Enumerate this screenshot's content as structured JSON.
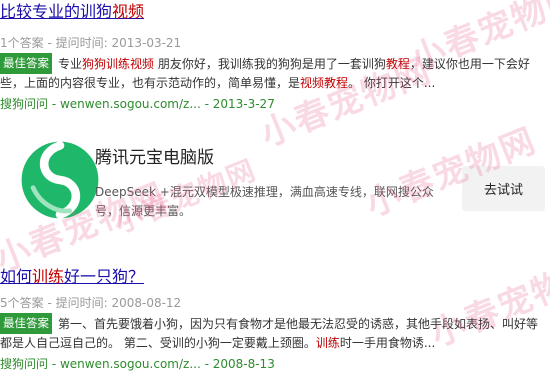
{
  "results": [
    {
      "title_parts": [
        {
          "text": "比较专业的训狗",
          "hl": false
        },
        {
          "text": "视频",
          "hl": true
        }
      ],
      "meta": "1个答案 - 提问时间: 2013-03-21",
      "badge": "最佳答案",
      "snippet_parts": [
        {
          "text": "专业",
          "hl": false
        },
        {
          "text": "狗狗训练视频",
          "hl": true
        },
        {
          "text": " 朋友你好，我训练我的狗狗是用了一套训狗",
          "hl": false
        },
        {
          "text": "教程",
          "hl": true
        },
        {
          "text": "，建议你也用一下会好些，上面的内容很专业，也有示范动作的，简单易懂，是",
          "hl": false
        },
        {
          "text": "视频教程",
          "hl": true
        },
        {
          "text": "。 你打开这个...",
          "hl": false
        }
      ],
      "source": "搜狗问问 - wenwen.sogou.com/z... - 2013-3-27"
    },
    {
      "title_parts": [
        {
          "text": "如何",
          "hl": false
        },
        {
          "text": "训练",
          "hl": true
        },
        {
          "text": "好一只狗？",
          "hl": false
        }
      ],
      "meta": "5个答案 - 提问时间: 2008-08-12",
      "badge": "最佳答案",
      "snippet_parts": [
        {
          "text": "第一、首先要饿着小狗，因为只有食物才是他最无法忍受的诱惑，其他手段如表扬、叫好等都是人自己逗自己的。 第二、受训的小狗一定要戴上颈圈。",
          "hl": false
        },
        {
          "text": "训练",
          "hl": true
        },
        {
          "text": "时一手用食物诱...",
          "hl": false
        }
      ],
      "source": "搜狗问问 - wenwen.sogou.com/z... - 2008-8-13"
    }
  ],
  "ad": {
    "title": "腾讯元宝电脑版",
    "description": "DeepSeek +混元双模型极速推理，满血高速专线，联网搜公众号，信源更丰富。",
    "button": "去试试",
    "logo_color": "#1fb86a"
  },
  "watermark": "小春宠物网",
  "colors": {
    "link": "#1a0dab",
    "highlight": "#c00000",
    "badge": "#2f9a3a",
    "source": "#2e8b2e",
    "meta": "#999999"
  }
}
